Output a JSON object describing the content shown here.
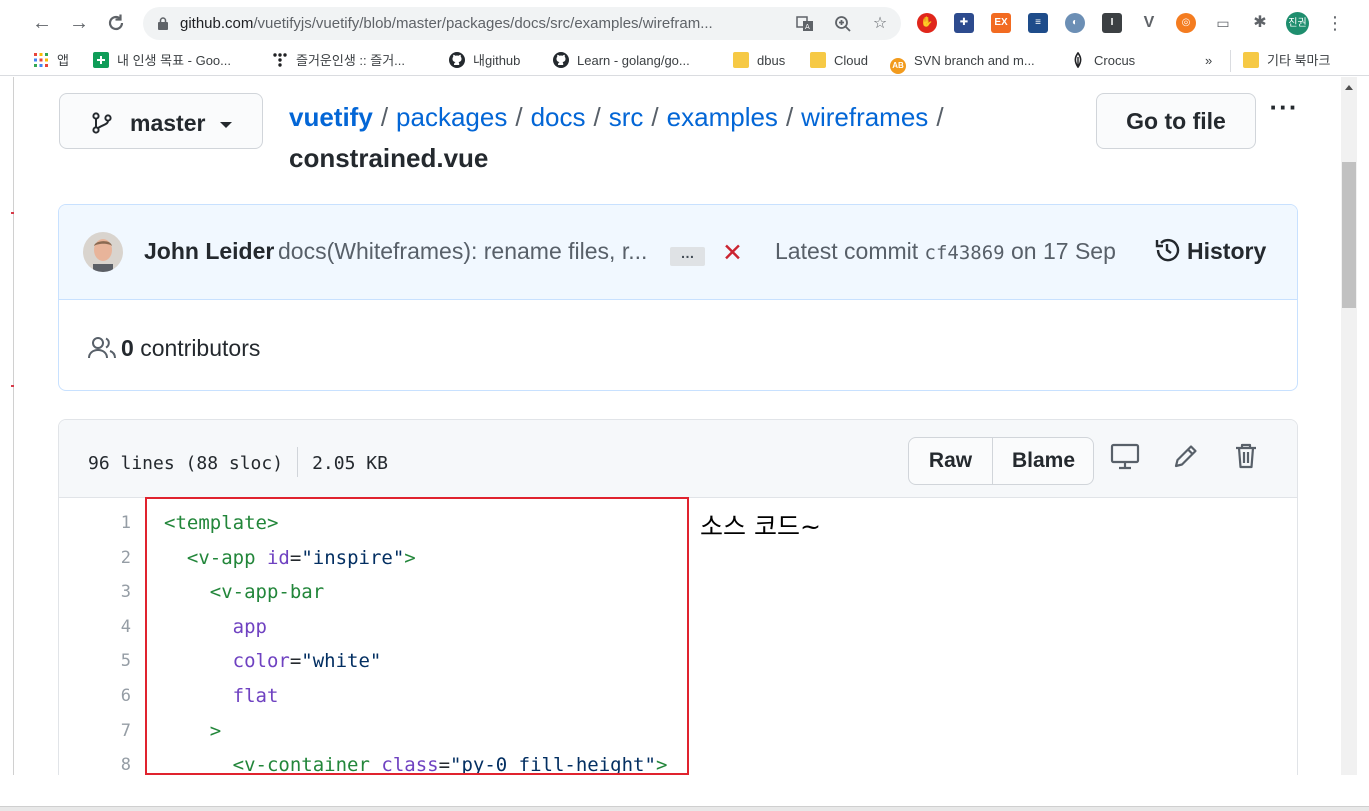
{
  "browser": {
    "url_host": "github.com",
    "url_path": "/vuetifyjs/vuetify/blob/master/packages/docs/src/examples/wirefram...",
    "profile_label": "진권",
    "menu_glyph": "⋮",
    "bookmarks": [
      {
        "label": "앱",
        "icon": "apps-grid-icon"
      },
      {
        "label": "내 인생 목표 - Goo...",
        "icon": "sheets-icon"
      },
      {
        "label": "즐거운인생 :: 즐거...",
        "icon": "blog-icon"
      },
      {
        "label": "내github",
        "icon": "github-icon"
      },
      {
        "label": "Learn - golang/go...",
        "icon": "github-icon"
      },
      {
        "label": "dbus",
        "icon": "folder-icon"
      },
      {
        "label": "Cloud",
        "icon": "folder-icon"
      },
      {
        "label": "SVN branch and m...",
        "icon": "ab-icon"
      },
      {
        "label": "Crocus",
        "icon": "crocus-icon"
      }
    ],
    "bookmarks_overflow": "»",
    "other_bookmarks": "기타 북마크"
  },
  "repo": {
    "branch": "master",
    "breadcrumb": [
      "vuetify",
      "packages",
      "docs",
      "src",
      "examples",
      "wireframes"
    ],
    "separator": "/",
    "file_name": "constrained.vue",
    "goto_label": "Go to file",
    "more_label": "···"
  },
  "commit": {
    "author": "John Leider",
    "message": "docs(Whiteframes): rename files, r...",
    "ellipsis": "…",
    "status": "✕",
    "latest_prefix": "Latest commit",
    "sha": "cf43869",
    "date": "on 17 Sep",
    "history_label": "History",
    "contributors_count": "0",
    "contributors_label": "contributors"
  },
  "file": {
    "lines_info": "96 lines (88 sloc)",
    "size": "2.05 KB",
    "raw_label": "Raw",
    "blame_label": "Blame"
  },
  "code_lines": [
    {
      "n": "1",
      "indent": "",
      "tokens": [
        {
          "t": "<template>",
          "c": "tag"
        }
      ]
    },
    {
      "n": "2",
      "indent": "  ",
      "tokens": [
        {
          "t": "<v-app",
          "c": "tag"
        },
        {
          "t": " ",
          "c": ""
        },
        {
          "t": "id",
          "c": "attr"
        },
        {
          "t": "=",
          "c": ""
        },
        {
          "t": "\"inspire\"",
          "c": "str"
        },
        {
          "t": ">",
          "c": "tag"
        }
      ]
    },
    {
      "n": "3",
      "indent": "    ",
      "tokens": [
        {
          "t": "<v-app-bar",
          "c": "tag"
        }
      ]
    },
    {
      "n": "4",
      "indent": "      ",
      "tokens": [
        {
          "t": "app",
          "c": "attr"
        }
      ]
    },
    {
      "n": "5",
      "indent": "      ",
      "tokens": [
        {
          "t": "color",
          "c": "attr"
        },
        {
          "t": "=",
          "c": ""
        },
        {
          "t": "\"white\"",
          "c": "str"
        }
      ]
    },
    {
      "n": "6",
      "indent": "      ",
      "tokens": [
        {
          "t": "flat",
          "c": "attr"
        }
      ]
    },
    {
      "n": "7",
      "indent": "    ",
      "tokens": [
        {
          "t": ">",
          "c": "tag"
        }
      ]
    },
    {
      "n": "8",
      "indent": "      ",
      "tokens": [
        {
          "t": "<v-container",
          "c": "tag"
        },
        {
          "t": " ",
          "c": ""
        },
        {
          "t": "class",
          "c": "attr"
        },
        {
          "t": "=",
          "c": ""
        },
        {
          "t": "\"py-0 fill-height\"",
          "c": "str"
        },
        {
          "t": ">",
          "c": "tag"
        }
      ]
    }
  ],
  "annotation": "소스 코드~",
  "colors": {
    "link": "#0366d6",
    "highlight_border": "#e0232e",
    "commit_bg": "#f1f8ff",
    "tag": "#22863a",
    "attr": "#6f42c1",
    "string": "#032f62"
  }
}
